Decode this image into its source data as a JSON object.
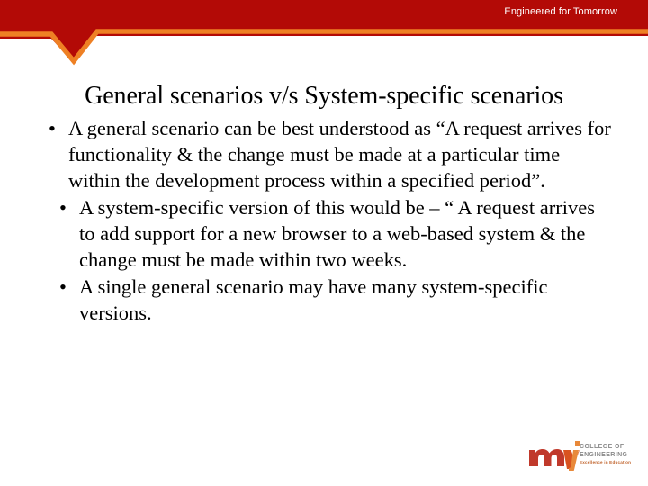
{
  "header": {
    "tagline": "Engineered for Tomorrow",
    "band_color": "#B30A06",
    "accent_color": "#EE8024"
  },
  "title": "General scenarios v/s System-specific scenarios",
  "body": {
    "bullets": [
      {
        "marker": "•",
        "indent": 1,
        "text": "A general scenario can be best understood as “A request arrives for functionality & the change must be made at a particular time within the development process within a specified period”."
      },
      {
        "marker": "•",
        "indent": 2,
        "text": "A system-specific version of this would be – “ A request arrives to add support for a new browser to a web-based system & the change must be made within two weeks."
      },
      {
        "marker": "•",
        "indent": 2,
        "text": "A single general scenario may have many system-specific versions."
      }
    ]
  },
  "logo": {
    "wordmark": "mvj",
    "line1": "COLLEGE OF",
    "line2": "ENGINEERING",
    "tagline": "Excellence in Education",
    "color_m": "#C0392B",
    "color_v": "#D9521F",
    "color_j": "#E8893A"
  }
}
